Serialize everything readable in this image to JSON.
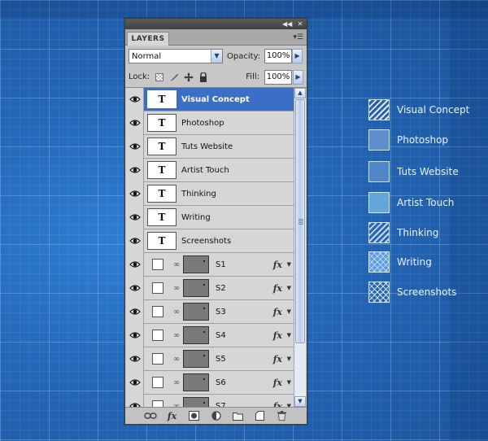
{
  "panel": {
    "tab_label": "LAYERS",
    "blend_mode": "Normal",
    "opacity_label": "Opacity:",
    "opacity_value": "100%",
    "lock_label": "Lock:",
    "fill_label": "Fill:",
    "fill_value": "100%",
    "layers": [
      {
        "name": "Visual Concept",
        "kind": "text",
        "thumb": "T",
        "selected": true
      },
      {
        "name": "Photoshop",
        "kind": "text",
        "thumb": "T"
      },
      {
        "name": "Tuts Website",
        "kind": "text",
        "thumb": "T"
      },
      {
        "name": "Artist Touch",
        "kind": "text",
        "thumb": "T"
      },
      {
        "name": "Thinking",
        "kind": "text",
        "thumb": "T"
      },
      {
        "name": "Writing",
        "kind": "text",
        "thumb": "T"
      },
      {
        "name": "Screenshots",
        "kind": "text",
        "thumb": "T"
      },
      {
        "name": "S1",
        "kind": "shape",
        "fx": "fx"
      },
      {
        "name": "S2",
        "kind": "shape",
        "fx": "fx"
      },
      {
        "name": "S3",
        "kind": "shape",
        "fx": "fx"
      },
      {
        "name": "S4",
        "kind": "shape",
        "fx": "fx"
      },
      {
        "name": "S5",
        "kind": "shape",
        "fx": "fx"
      },
      {
        "name": "S6",
        "kind": "shape",
        "fx": "fx"
      },
      {
        "name": "S7",
        "kind": "shape",
        "fx": "fx"
      }
    ],
    "bottom_tools": [
      "link-icon",
      "fx-icon",
      "mask-icon",
      "adjustment-icon",
      "folder-icon",
      "new-layer-icon",
      "trash-icon"
    ],
    "bottom_fx_label": "fx"
  },
  "legend": {
    "items": [
      {
        "label": "Visual Concept",
        "pattern": "diag"
      },
      {
        "label": "Photoshop",
        "pattern": "fill1"
      },
      {
        "label": "Tuts Website",
        "pattern": "fill2"
      },
      {
        "label": "Artist Touch",
        "pattern": "fill3"
      },
      {
        "label": "Thinking",
        "pattern": "diag2"
      },
      {
        "label": "Writing",
        "pattern": "cross"
      },
      {
        "label": "Screenshots",
        "pattern": "cross2"
      }
    ]
  },
  "colors": {
    "background": "#1f5da3",
    "selection": "#3b6fc5",
    "panel": "#c7c7c7"
  }
}
